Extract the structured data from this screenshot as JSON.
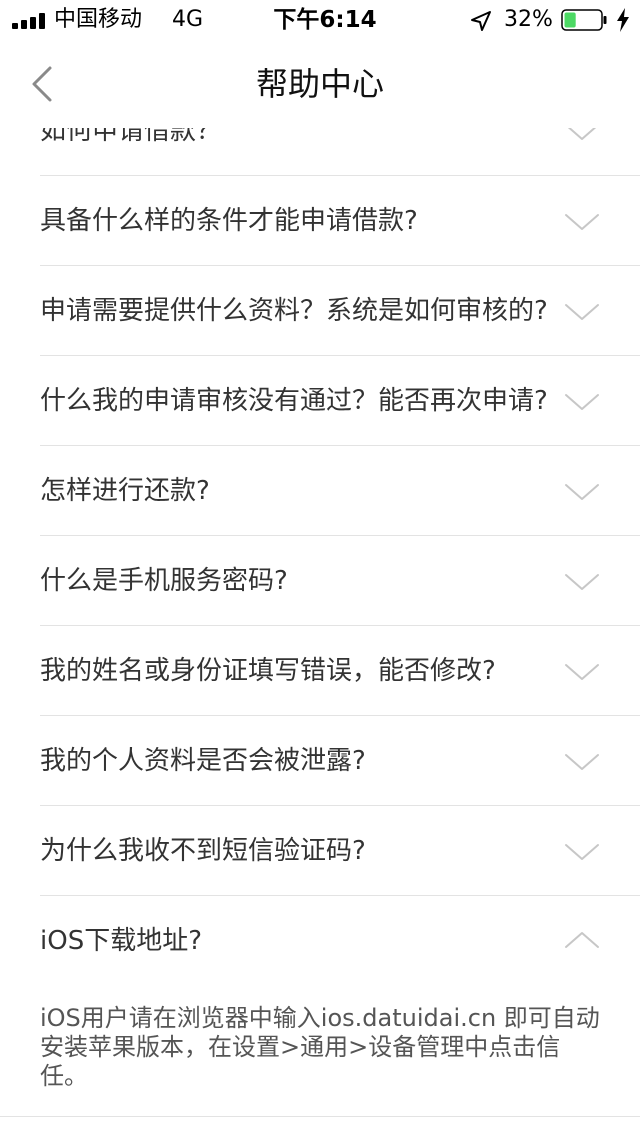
{
  "status_bar": {
    "carrier": "中国移动",
    "network": "4G",
    "time": "下午6:14",
    "battery_percent": "32%",
    "battery_level": 0.32,
    "battery_color": "#4cd964",
    "icons": [
      "signal-icon",
      "location-arrow-icon",
      "battery-icon",
      "charging-icon"
    ]
  },
  "nav": {
    "title": "帮助中心",
    "back_icon": "chevron-left-icon"
  },
  "faq": {
    "items": [
      {
        "question": "如何申请借款？",
        "expanded": false
      },
      {
        "question": "具备什么样的条件才能申请借款?",
        "expanded": false
      },
      {
        "question": "申请需要提供什么资料？系统是如何审核的?",
        "expanded": false
      },
      {
        "question": "什么我的申请审核没有通过？能否再次申请?",
        "expanded": false
      },
      {
        "question": "怎样进行还款?",
        "expanded": false
      },
      {
        "question": "什么是手机服务密码?",
        "expanded": false
      },
      {
        "question": "我的姓名或身份证填写错误，能否修改?",
        "expanded": false
      },
      {
        "question": "我的个人资料是否会被泄露?",
        "expanded": false
      },
      {
        "question": "为什么我收不到短信验证码?",
        "expanded": false
      },
      {
        "question": "iOS下载地址?",
        "expanded": true
      }
    ],
    "expanded_answer": "iOS用户请在浏览器中输入ios.datuidai.cn 即可自动安装苹果版本，在设置>通用>设备管理中点击信任。"
  }
}
